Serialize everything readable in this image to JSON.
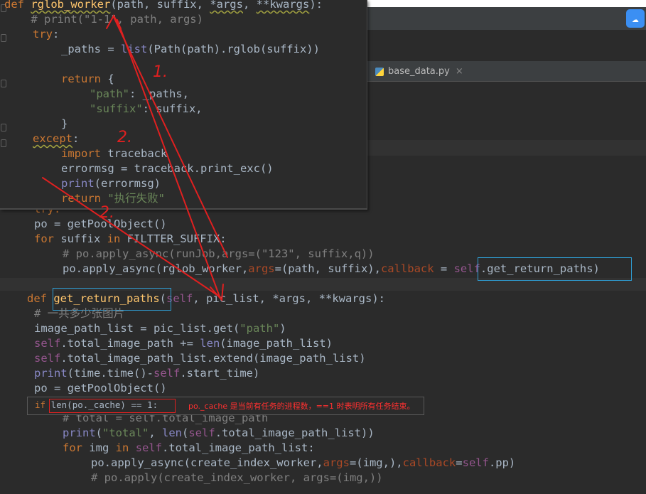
{
  "editor": {
    "tab_label": "base_data.py",
    "tab_close": "×",
    "cloud_icon": "cloud-sync-icon"
  },
  "popup_code": {
    "l1_def": "def",
    "l1_name": "rglob_worker",
    "l1_rest_a": "(path, suffix, ",
    "l1_args": "*args",
    "l1_comma": ", ",
    "l1_kwargs": "**kwargs",
    "l1_end": "):",
    "l2": "    # print(\"1-1\", path, args)",
    "l3": "try",
    "l4_a": "_paths = ",
    "l4_b": "list",
    "l4_c": "(Path(path).rglob(suffix))",
    "l6_a": "return",
    "l6_b": " {",
    "l7_a": "\"path\"",
    "l7_b": ": _paths,",
    "l8_a": "\"suffix\"",
    "l8_b": ": suffix,",
    "l9": "}",
    "l10": "except",
    "l11_a": "import",
    "l11_b": " traceback",
    "l12": "errormsg = traceback.print_exc()",
    "l13_a": "print",
    "l13_b": "(errormsg)",
    "l14_a": "return",
    "l14_b": " \"执行失败\""
  },
  "main_code": {
    "m0": "try:",
    "m1": "po = getPoolObject()",
    "m2_a": "for",
    "m2_b": " suffix ",
    "m2_c": "in",
    "m2_d": " FILTTER_SUFFIX:",
    "m3": "# po.apply_async(runJob,args=(\"123\", suffix,q))",
    "m4_a": "po.apply_async(rglob_worker,",
    "m4_b": "args",
    "m4_c": "=(path, suffix),",
    "m4_d": "callback",
    "m4_e": " = ",
    "m4_f": "self",
    "m4_g": ".get_return_paths)",
    "m5_a": "def",
    "m5_b": "get_return_paths",
    "m5_c": "(",
    "m5_d": "self",
    "m5_e": ", pic_list, ",
    "m5_f": "*args",
    "m5_g": ", ",
    "m5_h": "**kwargs",
    "m5_i": "):",
    "m6": "# 一共多少张图片",
    "m7_a": "image_path_list = pic_list.get(",
    "m7_b": "\"path\"",
    "m7_c": ")",
    "m8_a": "self",
    "m8_b": ".total_image_path += ",
    "m8_c": "len",
    "m8_d": "(image_path_list)",
    "m9_a": "self",
    "m9_b": ".total_image_path_list.extend(image_path_list)",
    "m10_a": "print",
    "m10_b": "(time.time()-",
    "m10_c": "self",
    "m10_d": ".start_time)",
    "m11": "po = getPoolObject()",
    "m13_a": "# total = ",
    "m13_b": "self.total_image_path",
    "m14_a": "print",
    "m14_b": "(",
    "m14_c": "\"total\"",
    "m14_d": ", ",
    "m14_e": "len",
    "m14_f": "(",
    "m14_g": "self",
    "m14_h": ".total_image_path_list))",
    "m15_a": "for",
    "m15_b": " img ",
    "m15_c": "in",
    "m15_d": " ",
    "m15_e": "self",
    "m15_f": ".total_image_path_list:",
    "m16_a": "po.apply_async(create_index_worker,",
    "m16_b": "args",
    "m16_c": "=(img,),",
    "m16_d": "callback",
    "m16_e": "=",
    "m16_f": "self",
    "m16_g": ".pp)",
    "m17": "# po.apply(create_index_worker, args=(img,))"
  },
  "note": {
    "if_kw": "if",
    "condition": "len(po._cache) == 1:",
    "text": "po._cache 是当前有任务的进程数，==1 时表明所有任务结束。"
  },
  "annotations": {
    "mark1": "1.",
    "mark2a": "2.",
    "mark2b": "2."
  },
  "colors": {
    "background": "#2b2b2b",
    "keyword": "#cc7832",
    "function": "#ffc66d",
    "string": "#6a8759",
    "comment": "#808080",
    "self": "#94558d",
    "arrow": "#e02020",
    "highlight_box": "#2f9fd6"
  }
}
